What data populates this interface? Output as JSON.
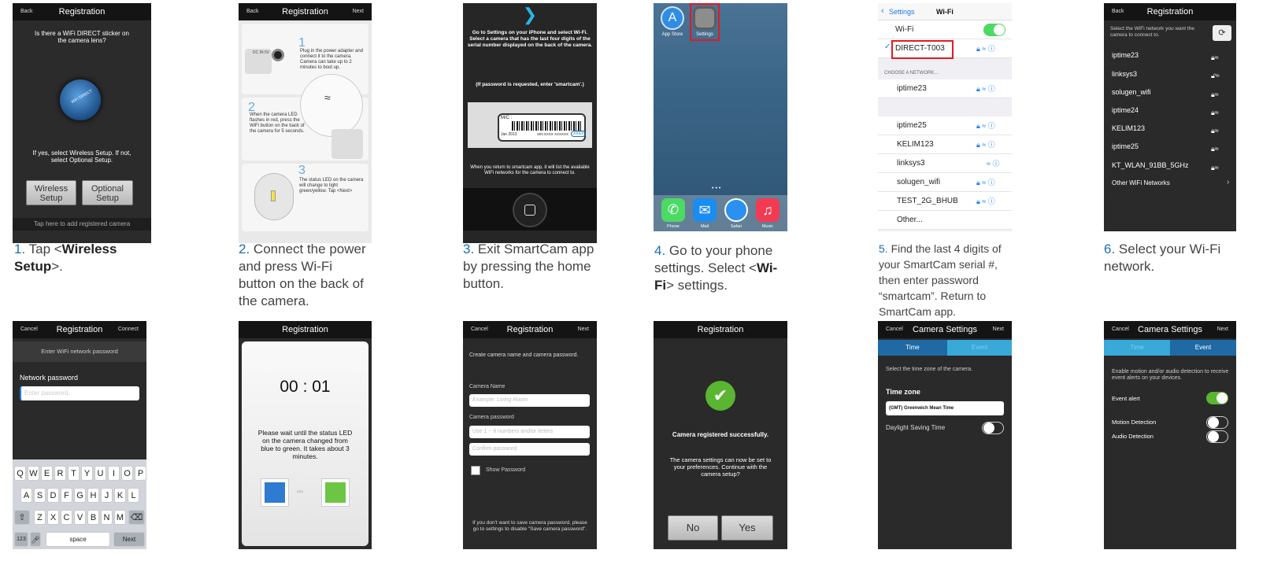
{
  "steps": [
    {
      "num": "1.",
      "pre": "Tap <",
      "bold": "Wireless Setup",
      "post": ">."
    },
    {
      "num": "2.",
      "text": "Connect the power and press Wi-Fi button on the back of the camera."
    },
    {
      "num": "3.",
      "text": "Exit SmartCam app by pressing the home button."
    },
    {
      "num": "4.",
      "pre": "Go to your phone settings. Select <",
      "bold": "Wi-Fi",
      "post": "> settings."
    },
    {
      "num": "5.",
      "text": "Find the last 4 digits of your SmartCam serial #, then enter password “smartcam”. Return to SmartCam app."
    },
    {
      "num": "6.",
      "text": "Select your Wi-Fi network."
    }
  ],
  "s1": {
    "back": "Back",
    "title": "Registration",
    "question": "Is there a WiFi DIRECT sticker on the camera lens?",
    "sticker": "WiFi DIRECT",
    "answer": "If yes, select Wireless Setup. If not, select Optional Setup.",
    "wireless": "Wireless Setup",
    "optional": "Optional Setup",
    "footer": "Tap here to add registered camera"
  },
  "s2": {
    "back": "Back",
    "title": "Registration",
    "next": "Next",
    "n1": "1",
    "t1": "Plug in the power adapter and connect it to the camera. Camera can take up to 2 minutes to boot up.",
    "dc": "DC IN 5V",
    "n2": "2",
    "t2": "When the camera LED flashes in red, press the WiFi button on the back of the camera for 5 seconds.",
    "n3": "3",
    "t3": "The status LED on the camera will change to light green/yellow. Tap <Next>"
  },
  "s3": {
    "top": "Go to Settings on your iPhone and select Wi-Fi. Select a camera that has the last four digits of the serial number displayed on the back of the camera.",
    "pw": "(If password is requested, enter 'smartcam'.)",
    "mc": "M/C :",
    "date": "Jan 2013",
    "sn": "S/N:XXXX XXXXXX",
    "sn2": "XXXX",
    "bottom": "When you return to smartcam app, it will list the available WiFi networks for the camera to connect to."
  },
  "s4": {
    "appstore": "App Store",
    "settings": "Settings",
    "phone": "Phone",
    "mail": "Mail",
    "safari": "Safari",
    "music": "Music"
  },
  "s5": {
    "back": "Settings",
    "title": "Wi-Fi",
    "wifi": "Wi-Fi",
    "selected": "DIRECT-T003",
    "choose": "CHOOSE A NETWORK...",
    "nets": [
      "iptime23",
      "iptime25",
      "KELIM123",
      "linksys3",
      "solugen_wifi",
      "TEST_2G_BHUB",
      "Other..."
    ]
  },
  "s6": {
    "back": "Back",
    "title": "Registration",
    "msg": "Select the WiFi network you want the camera to connect to.",
    "nets": [
      "iptime23",
      "linksys3",
      "solugen_wifi",
      "iptime24",
      "KELIM123",
      "iptime25",
      "KT_WLAN_91BB_5GHz",
      "Other WiFi Networks"
    ]
  },
  "s7": {
    "cancel": "Cancel",
    "title": "Registration",
    "connect": "Connect",
    "msg": "Enter WiFi network password",
    "label": "Network password",
    "placeholder": "Enter password.",
    "row1": [
      "Q",
      "W",
      "E",
      "R",
      "T",
      "Y",
      "U",
      "I",
      "O",
      "P"
    ],
    "row2": [
      "A",
      "S",
      "D",
      "F",
      "G",
      "H",
      "J",
      "K",
      "L"
    ],
    "row3": [
      "Z",
      "X",
      "C",
      "V",
      "B",
      "N",
      "M"
    ],
    "num": "123",
    "space": "space",
    "next": "Next"
  },
  "s8": {
    "title": "Registration",
    "timer": "00 : 01",
    "msg": "Please wait until the status LED on the camera changed from blue to green. It takes about 3 minutes."
  },
  "s9": {
    "cancel": "Cancel",
    "title": "Registration",
    "next": "Next",
    "msg": "Create camera name and camera password.",
    "name_label": "Camera Name",
    "name_ph": "Example: Living Room",
    "pw_label": "Camera password",
    "pw_ph": "Use 1 ~ 8 numbers and/or letters",
    "confirm_ph": "Confirm password",
    "show": "Show Password",
    "bottom": "If you don't want to save camera password, please go to settings to disable \"Save camera password\"."
  },
  "s10": {
    "title": "Registration",
    "success": "Camera registered successfully.",
    "msg": "The camera settings can now be set to your preferences. Continue with the camera setup?",
    "no": "No",
    "yes": "Yes"
  },
  "s11": {
    "cancel": "Cancel",
    "title": "Camera Settings",
    "next": "Next",
    "tab_time": "Time",
    "tab_event": "Event",
    "msg": "Select the time zone of the camera.",
    "tz_label": "Time zone",
    "tz_value": "(GMT) Greenwich Mean Time",
    "dst": "Daylight Saving Time"
  },
  "s12": {
    "cancel": "Cancel",
    "title": "Camera Settings",
    "next": "Next",
    "tab_time": "Time",
    "tab_event": "Event",
    "msg": "Enable motion and/or audio detection to receive event alerts on your devices.",
    "alert": "Event alert",
    "motion": "Motion Detection",
    "audio": "Audio Detection"
  },
  "colors": {
    "accent": "#1a6fb3",
    "green": "#4cd964",
    "ios_blue": "#1a7cf5",
    "cyan": "#38a9d8"
  }
}
